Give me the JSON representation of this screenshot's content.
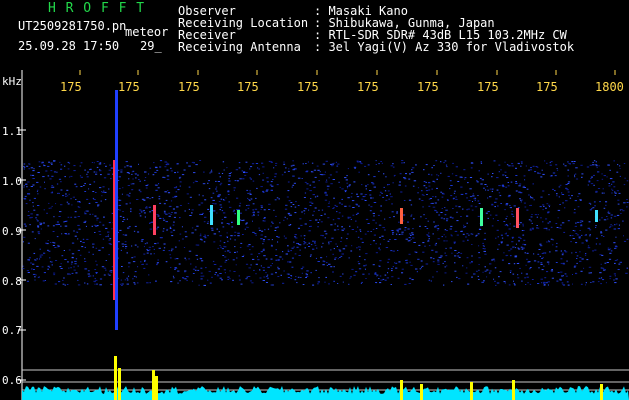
{
  "header": {
    "brand": "H R O F F T",
    "filename": "UT2509281750.pn",
    "filename_suffix": "meteor",
    "datetime": "25.09.28 17:50",
    "count": "29_",
    "fields": [
      {
        "label": "Observer",
        "value": ": Masaki Kano"
      },
      {
        "label": "Receiving Location",
        "value": ": Shibukawa, Gunma, Japan"
      },
      {
        "label": "Receiver",
        "value": ": RTL-SDR SDR# 43dB L15 103.2MHz CW"
      },
      {
        "label": "Receiving Antenna",
        "value": ": 3el Yagi(V) Az 330 for Vladivostok"
      }
    ]
  },
  "axes": {
    "y_unit": "kHz",
    "y_ticks": [
      "1.1",
      "1.0",
      "0.9",
      "0.8",
      "0.7",
      "0.6"
    ],
    "x_ticks": [
      "175",
      "175",
      "175",
      "175",
      "175",
      "175",
      "175",
      "175",
      "175",
      "1800"
    ]
  },
  "colors": {
    "brand": "#22d84a",
    "header_text": "#ffffff",
    "x_ticks": "#ffd84a",
    "noise_band": "#1e2fbe",
    "spectrum": "#00e5ff",
    "peaks": "#ffff00"
  }
}
